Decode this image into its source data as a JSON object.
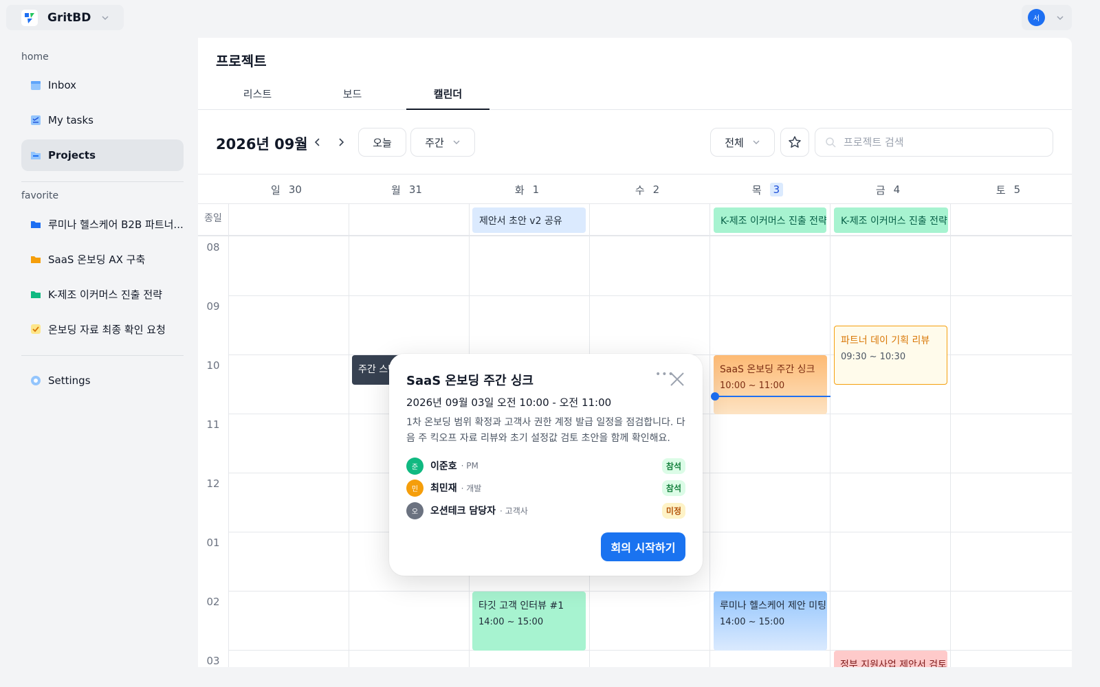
{
  "app": {
    "name": "GritBD",
    "user_initial": "서"
  },
  "sidebar": {
    "home_label": "home",
    "home_items": [
      {
        "label": "Inbox",
        "icon": "inbox-icon"
      },
      {
        "label": "My tasks",
        "icon": "tasks-icon"
      },
      {
        "label": "Projects",
        "icon": "folder-icon",
        "active": true
      }
    ],
    "favorite_label": "favorite",
    "favorite_items": [
      {
        "label": "루미나 헬스케어 B2B 파트너...",
        "icon": "folder-icon",
        "color": "#1d6ff2"
      },
      {
        "label": "SaaS 온보딩 AX 구축",
        "icon": "folder-icon",
        "color": "#f59e0b"
      },
      {
        "label": "K-제조 이커머스 진출 전략",
        "icon": "folder-icon",
        "color": "#10b981"
      },
      {
        "label": "온보딩 자료 최종 확인 요청",
        "icon": "checkbox-icon",
        "color": "#f59e0b"
      }
    ],
    "settings_label": "Settings"
  },
  "page": {
    "title": "프로젝트"
  },
  "tabs": [
    {
      "label": "리스트"
    },
    {
      "label": "보드"
    },
    {
      "label": "캘린더",
      "active": true
    }
  ],
  "toolbar": {
    "month_label": "2026년 09월",
    "today_label": "오늘",
    "view_label": "주간",
    "filter_label": "전체",
    "search_placeholder": "프로젝트 검색"
  },
  "calendar": {
    "days": [
      {
        "dow": "일",
        "num": "30"
      },
      {
        "dow": "월",
        "num": "31"
      },
      {
        "dow": "화",
        "num": "1"
      },
      {
        "dow": "수",
        "num": "2"
      },
      {
        "dow": "목",
        "num": "3",
        "today": true
      },
      {
        "dow": "금",
        "num": "4"
      },
      {
        "dow": "토",
        "num": "5"
      }
    ],
    "allday_label": "종일",
    "hours": [
      "08",
      "09",
      "10",
      "11",
      "12",
      "01",
      "02",
      "03"
    ],
    "allday_events": [
      {
        "title": "제안서 초안 v2 공유",
        "day": "화 1",
        "color": "#dbeafe"
      },
      {
        "title": "K-제조 이커머스 진출 전략 -",
        "day": "목 3",
        "color": "#a7f3d0"
      },
      {
        "title": "K-제조 이커머스 진출 전략 -",
        "day": "금 4",
        "color": "#a7f3d0"
      }
    ],
    "events": [
      {
        "title": "주간 스탠",
        "time": "",
        "day": "월 31",
        "color": "#374151"
      },
      {
        "title": "SaaS 온보딩 주간 싱크",
        "time": "10:00 ~ 11:00",
        "day": "목 3",
        "color": "#fdba74"
      },
      {
        "title": "파트너 데이 기획 리뷰",
        "time": "09:30 ~ 10:30",
        "day": "금 4",
        "color": "#f59e0b"
      },
      {
        "title": "타깃 고객 인터뷰 #1",
        "time": "14:00 ~ 15:00",
        "day": "화 1",
        "color": "#a7f3d0"
      },
      {
        "title": "루미나 헬스케어 제안 미팅",
        "time": "14:00 ~ 15:00",
        "day": "목 3",
        "color": "#bfdbfe"
      },
      {
        "title": "정부 지원사업 제안서 검토",
        "time": "",
        "day": "금 4",
        "color": "#fecaca"
      }
    ]
  },
  "popover": {
    "title": "SaaS 온보딩 주간 싱크",
    "datetime": "2026년 09월 03일 오전 10:00 - 오전 11:00",
    "description": "1차 온보딩 범위 확정과 고객사 권한 계정 발급 일정을 점검합니다. 다음 주 킥오프 자료 리뷰와 초기 설정값 검토 초안을 함께 확인해요.",
    "attendees": [
      {
        "initial": "준",
        "name": "이준호",
        "role": "· PM",
        "status": "참석",
        "color": "#10b981"
      },
      {
        "initial": "민",
        "name": "최민재",
        "role": "· 개발",
        "status": "참석",
        "color": "#f59e0b"
      },
      {
        "initial": "오",
        "name": "오션테크 담당자",
        "role": "· 고객사",
        "status": "미정",
        "color": "#6b7280"
      }
    ],
    "start_button": "회의 시작하기"
  }
}
